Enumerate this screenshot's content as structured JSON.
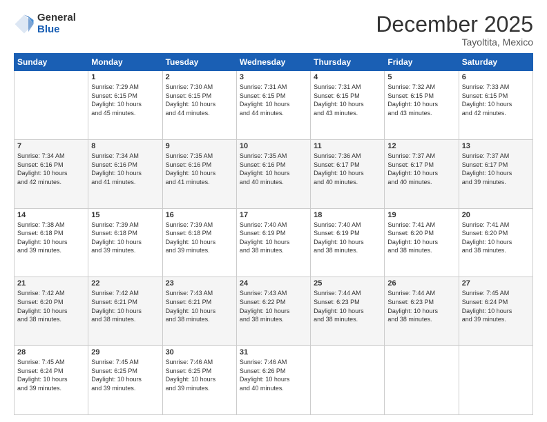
{
  "logo": {
    "general": "General",
    "blue": "Blue"
  },
  "header": {
    "title": "December 2025",
    "subtitle": "Tayoltita, Mexico"
  },
  "days_of_week": [
    "Sunday",
    "Monday",
    "Tuesday",
    "Wednesday",
    "Thursday",
    "Friday",
    "Saturday"
  ],
  "weeks": [
    {
      "shaded": false,
      "days": [
        {
          "num": "",
          "info": ""
        },
        {
          "num": "1",
          "info": "Sunrise: 7:29 AM\nSunset: 6:15 PM\nDaylight: 10 hours\nand 45 minutes."
        },
        {
          "num": "2",
          "info": "Sunrise: 7:30 AM\nSunset: 6:15 PM\nDaylight: 10 hours\nand 44 minutes."
        },
        {
          "num": "3",
          "info": "Sunrise: 7:31 AM\nSunset: 6:15 PM\nDaylight: 10 hours\nand 44 minutes."
        },
        {
          "num": "4",
          "info": "Sunrise: 7:31 AM\nSunset: 6:15 PM\nDaylight: 10 hours\nand 43 minutes."
        },
        {
          "num": "5",
          "info": "Sunrise: 7:32 AM\nSunset: 6:15 PM\nDaylight: 10 hours\nand 43 minutes."
        },
        {
          "num": "6",
          "info": "Sunrise: 7:33 AM\nSunset: 6:15 PM\nDaylight: 10 hours\nand 42 minutes."
        }
      ]
    },
    {
      "shaded": true,
      "days": [
        {
          "num": "7",
          "info": "Sunrise: 7:34 AM\nSunset: 6:16 PM\nDaylight: 10 hours\nand 42 minutes."
        },
        {
          "num": "8",
          "info": "Sunrise: 7:34 AM\nSunset: 6:16 PM\nDaylight: 10 hours\nand 41 minutes."
        },
        {
          "num": "9",
          "info": "Sunrise: 7:35 AM\nSunset: 6:16 PM\nDaylight: 10 hours\nand 41 minutes."
        },
        {
          "num": "10",
          "info": "Sunrise: 7:35 AM\nSunset: 6:16 PM\nDaylight: 10 hours\nand 40 minutes."
        },
        {
          "num": "11",
          "info": "Sunrise: 7:36 AM\nSunset: 6:17 PM\nDaylight: 10 hours\nand 40 minutes."
        },
        {
          "num": "12",
          "info": "Sunrise: 7:37 AM\nSunset: 6:17 PM\nDaylight: 10 hours\nand 40 minutes."
        },
        {
          "num": "13",
          "info": "Sunrise: 7:37 AM\nSunset: 6:17 PM\nDaylight: 10 hours\nand 39 minutes."
        }
      ]
    },
    {
      "shaded": false,
      "days": [
        {
          "num": "14",
          "info": "Sunrise: 7:38 AM\nSunset: 6:18 PM\nDaylight: 10 hours\nand 39 minutes."
        },
        {
          "num": "15",
          "info": "Sunrise: 7:39 AM\nSunset: 6:18 PM\nDaylight: 10 hours\nand 39 minutes."
        },
        {
          "num": "16",
          "info": "Sunrise: 7:39 AM\nSunset: 6:18 PM\nDaylight: 10 hours\nand 39 minutes."
        },
        {
          "num": "17",
          "info": "Sunrise: 7:40 AM\nSunset: 6:19 PM\nDaylight: 10 hours\nand 38 minutes."
        },
        {
          "num": "18",
          "info": "Sunrise: 7:40 AM\nSunset: 6:19 PM\nDaylight: 10 hours\nand 38 minutes."
        },
        {
          "num": "19",
          "info": "Sunrise: 7:41 AM\nSunset: 6:20 PM\nDaylight: 10 hours\nand 38 minutes."
        },
        {
          "num": "20",
          "info": "Sunrise: 7:41 AM\nSunset: 6:20 PM\nDaylight: 10 hours\nand 38 minutes."
        }
      ]
    },
    {
      "shaded": true,
      "days": [
        {
          "num": "21",
          "info": "Sunrise: 7:42 AM\nSunset: 6:20 PM\nDaylight: 10 hours\nand 38 minutes."
        },
        {
          "num": "22",
          "info": "Sunrise: 7:42 AM\nSunset: 6:21 PM\nDaylight: 10 hours\nand 38 minutes."
        },
        {
          "num": "23",
          "info": "Sunrise: 7:43 AM\nSunset: 6:21 PM\nDaylight: 10 hours\nand 38 minutes."
        },
        {
          "num": "24",
          "info": "Sunrise: 7:43 AM\nSunset: 6:22 PM\nDaylight: 10 hours\nand 38 minutes."
        },
        {
          "num": "25",
          "info": "Sunrise: 7:44 AM\nSunset: 6:23 PM\nDaylight: 10 hours\nand 38 minutes."
        },
        {
          "num": "26",
          "info": "Sunrise: 7:44 AM\nSunset: 6:23 PM\nDaylight: 10 hours\nand 38 minutes."
        },
        {
          "num": "27",
          "info": "Sunrise: 7:45 AM\nSunset: 6:24 PM\nDaylight: 10 hours\nand 39 minutes."
        }
      ]
    },
    {
      "shaded": false,
      "days": [
        {
          "num": "28",
          "info": "Sunrise: 7:45 AM\nSunset: 6:24 PM\nDaylight: 10 hours\nand 39 minutes."
        },
        {
          "num": "29",
          "info": "Sunrise: 7:45 AM\nSunset: 6:25 PM\nDaylight: 10 hours\nand 39 minutes."
        },
        {
          "num": "30",
          "info": "Sunrise: 7:46 AM\nSunset: 6:25 PM\nDaylight: 10 hours\nand 39 minutes."
        },
        {
          "num": "31",
          "info": "Sunrise: 7:46 AM\nSunset: 6:26 PM\nDaylight: 10 hours\nand 40 minutes."
        },
        {
          "num": "",
          "info": ""
        },
        {
          "num": "",
          "info": ""
        },
        {
          "num": "",
          "info": ""
        }
      ]
    }
  ]
}
